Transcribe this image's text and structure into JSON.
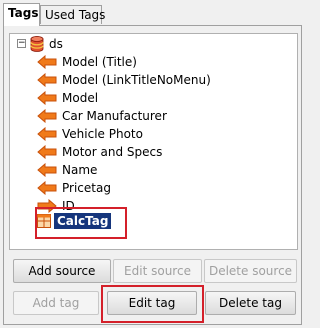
{
  "tabs": [
    {
      "label": "Tags",
      "active": true
    },
    {
      "label": "Used Tags",
      "active": false
    }
  ],
  "tree": {
    "root": {
      "label": "ds",
      "icon": "database-icon",
      "expanded": true
    },
    "children": [
      {
        "label": "Model (Title)",
        "icon": "arrow-tag-icon"
      },
      {
        "label": "Model (LinkTitleNoMenu)",
        "icon": "arrow-tag-icon"
      },
      {
        "label": "Model",
        "icon": "arrow-tag-icon"
      },
      {
        "label": "Car Manufacturer",
        "icon": "arrow-tag-icon"
      },
      {
        "label": "Vehicle Photo",
        "icon": "arrow-tag-icon"
      },
      {
        "label": "Motor and Specs",
        "icon": "arrow-tag-icon"
      },
      {
        "label": "Name",
        "icon": "arrow-tag-icon"
      },
      {
        "label": "Pricetag",
        "icon": "arrow-tag-icon"
      },
      {
        "label": "ID",
        "icon": "arrow-right-icon"
      }
    ],
    "selected": {
      "label": "CalcTag",
      "icon": "grid-table-icon"
    }
  },
  "source_buttons": {
    "add": {
      "label": "Add source",
      "enabled": true
    },
    "edit": {
      "label": "Edit source",
      "enabled": false
    },
    "delete": {
      "label": "Delete source",
      "enabled": false
    }
  },
  "tag_buttons": {
    "add": {
      "label": "Add tag",
      "enabled": false
    },
    "edit": {
      "label": "Edit tag",
      "enabled": true
    },
    "delete": {
      "label": "Delete tag",
      "enabled": true
    }
  },
  "colors": {
    "arrow_fill": "#f07a1a",
    "arrow_dark": "#c8500a",
    "selection": "#15357c",
    "highlight_box": "#d4202a"
  }
}
